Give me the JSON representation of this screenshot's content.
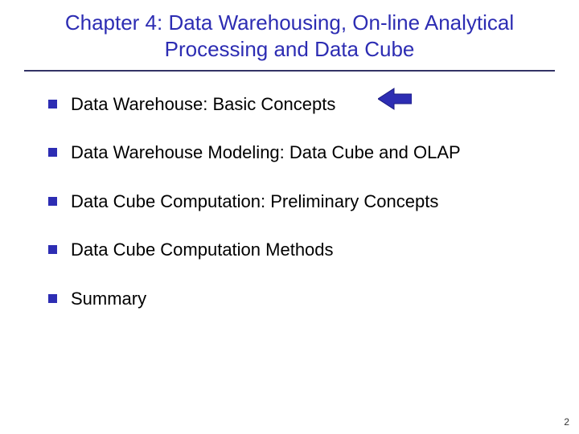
{
  "title": "Chapter 4: Data Warehousing, On-line Analytical Processing and Data Cube",
  "outline": {
    "items": [
      "Data Warehouse: Basic Concepts",
      "Data Warehouse Modeling: Data Cube and OLAP",
      "Data Cube Computation: Preliminary Concepts",
      "Data Cube Computation Methods",
      "Summary"
    ]
  },
  "page_number": "2",
  "arrow": {
    "points_to_item_index": 0,
    "color": "#2d2db3"
  }
}
